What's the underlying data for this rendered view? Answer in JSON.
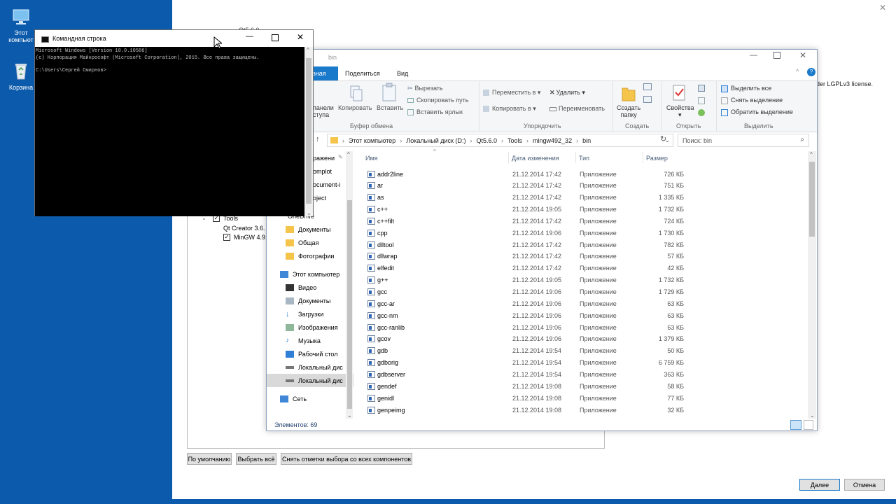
{
  "desktop": {
    "icons": [
      {
        "label_line1": "Этот",
        "label_line2": "компьют",
        "icon": "computer-icon"
      },
      {
        "label_line1": "Корзина",
        "label_line2": "",
        "icon": "recycle-bin-icon"
      }
    ]
  },
  "installer": {
    "partial_title": "Qt5.6.0",
    "license_fragment": "der LGPLv3 license.",
    "tree": {
      "tools_label": "Tools",
      "qt_creator_label": "Qt Creator 3.6.",
      "mingw_label": "MinGW 4.9."
    },
    "buttons": {
      "defaults": "По умолчанию",
      "select_all": "Выбрать всё",
      "deselect_all": "Снять отметки выбора со всех компонентов",
      "next": "Далее",
      "cancel": "Отмена"
    }
  },
  "explorer": {
    "title": "bin",
    "tabs": {
      "home_partial": "вная",
      "share": "Поделиться",
      "view": "Вид"
    },
    "ribbon": {
      "pin_partial": "панели\nступа",
      "copy": "Копировать",
      "paste": "Вставить",
      "cut": "Вырезать",
      "copy_path": "Скопировать путь",
      "paste_shortcut": "Вставить ярлык",
      "move_to": "Переместить в",
      "copy_to": "Копировать в",
      "delete": "Удалить",
      "rename": "Переименовать",
      "new_folder": "Создать\nпапку",
      "properties": "Свойства",
      "select_all": "Выделить все",
      "deselect": "Снять выделение",
      "invert": "Обратить выделение",
      "groups": {
        "clipboard": "Буфер обмена",
        "organize": "Упорядочить",
        "create": "Создать",
        "open": "Открыть",
        "select": "Выделить"
      }
    },
    "breadcrumb": [
      "Этот компьютер",
      "Локальный диск (D:)",
      "Qt5.6.0",
      "Tools",
      "mingw492_32",
      "bin"
    ],
    "search_placeholder": "Поиск: bin",
    "nav": {
      "fragments": [
        "ражени",
        "omplot",
        "ocument-i",
        "oject"
      ],
      "onedrive_partial": "OneDrive",
      "items": [
        {
          "label": "Документы",
          "icon": "folder-icon",
          "color": "#f4c54a"
        },
        {
          "label": "Общая",
          "icon": "folder-icon",
          "color": "#f4c54a"
        },
        {
          "label": "Фотографии",
          "icon": "folder-icon",
          "color": "#f4c54a"
        },
        {
          "label": "Этот компьютер",
          "icon": "computer-icon",
          "color": "#3f86d6"
        },
        {
          "label": "Видео",
          "icon": "video-icon",
          "color": "#333"
        },
        {
          "label": "Документы",
          "icon": "documents-icon",
          "color": "#8aa"
        },
        {
          "label": "Загрузки",
          "icon": "download-icon",
          "color": "#2f7fd6"
        },
        {
          "label": "Изображения",
          "icon": "images-icon",
          "color": "#5a7"
        },
        {
          "label": "Музыка",
          "icon": "music-icon",
          "color": "#2f7fd6"
        },
        {
          "label": "Рабочий стол",
          "icon": "desktop-icon",
          "color": "#2f7fd6"
        },
        {
          "label": "Локальный дис",
          "icon": "drive-icon",
          "color": "#555"
        },
        {
          "label": "Локальный дис",
          "icon": "drive-icon",
          "color": "#555"
        },
        {
          "label": "Сеть",
          "icon": "network-icon",
          "color": "#3f86d6"
        }
      ]
    },
    "columns": {
      "name": "Имя",
      "date": "Дата изменения",
      "type": "Тип",
      "size": "Размер"
    },
    "files": [
      {
        "name": "addr2line",
        "date": "21.12.2014 17:42",
        "type": "Приложение",
        "size": "726 КБ"
      },
      {
        "name": "ar",
        "date": "21.12.2014 17:42",
        "type": "Приложение",
        "size": "751 КБ"
      },
      {
        "name": "as",
        "date": "21.12.2014 17:42",
        "type": "Приложение",
        "size": "1 335 КБ"
      },
      {
        "name": "c++",
        "date": "21.12.2014 19:05",
        "type": "Приложение",
        "size": "1 732 КБ"
      },
      {
        "name": "c++filt",
        "date": "21.12.2014 17:42",
        "type": "Приложение",
        "size": "724 КБ"
      },
      {
        "name": "cpp",
        "date": "21.12.2014 19:06",
        "type": "Приложение",
        "size": "1 730 КБ"
      },
      {
        "name": "dlltool",
        "date": "21.12.2014 17:42",
        "type": "Приложение",
        "size": "782 КБ"
      },
      {
        "name": "dllwrap",
        "date": "21.12.2014 17:42",
        "type": "Приложение",
        "size": "57 КБ"
      },
      {
        "name": "elfedit",
        "date": "21.12.2014 17:42",
        "type": "Приложение",
        "size": "42 КБ"
      },
      {
        "name": "g++",
        "date": "21.12.2014 19:05",
        "type": "Приложение",
        "size": "1 732 КБ"
      },
      {
        "name": "gcc",
        "date": "21.12.2014 19:06",
        "type": "Приложение",
        "size": "1 729 КБ"
      },
      {
        "name": "gcc-ar",
        "date": "21.12.2014 19:06",
        "type": "Приложение",
        "size": "63 КБ"
      },
      {
        "name": "gcc-nm",
        "date": "21.12.2014 19:06",
        "type": "Приложение",
        "size": "63 КБ"
      },
      {
        "name": "gcc-ranlib",
        "date": "21.12.2014 19:06",
        "type": "Приложение",
        "size": "63 КБ"
      },
      {
        "name": "gcov",
        "date": "21.12.2014 19:06",
        "type": "Приложение",
        "size": "1 379 КБ"
      },
      {
        "name": "gdb",
        "date": "21.12.2014 19:54",
        "type": "Приложение",
        "size": "50 КБ"
      },
      {
        "name": "gdborig",
        "date": "21.12.2014 19:54",
        "type": "Приложение",
        "size": "6 759 КБ"
      },
      {
        "name": "gdbserver",
        "date": "21.12.2014 19:54",
        "type": "Приложение",
        "size": "363 КБ"
      },
      {
        "name": "gendef",
        "date": "21.12.2014 19:08",
        "type": "Приложение",
        "size": "58 КБ"
      },
      {
        "name": "genidl",
        "date": "21.12.2014 19:08",
        "type": "Приложение",
        "size": "77 КБ"
      },
      {
        "name": "genpeimg",
        "date": "21.12.2014 19:08",
        "type": "Приложение",
        "size": "32 КБ"
      }
    ],
    "status": "Элементов: 69"
  },
  "cmd": {
    "title": "Командная строка",
    "lines": [
      "Microsoft Windows [Version 10.0.10586]",
      "(c) Корпорация Майкрософт (Microsoft Corporation), 2015. Все права защищены.",
      "",
      "C:\\Users\\Сергей Смирнов>"
    ]
  },
  "colors": {
    "desktop": "#0c5aab",
    "accent": "#1979ca"
  }
}
